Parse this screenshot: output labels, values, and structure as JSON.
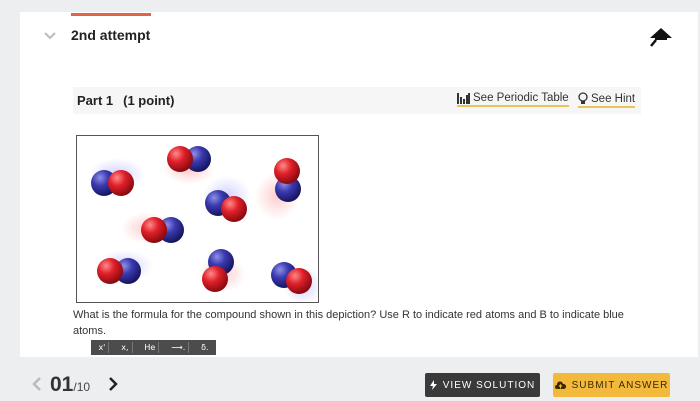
{
  "attempt": {
    "title": "2nd attempt"
  },
  "part": {
    "title": "Part 1",
    "points": "(1 point)",
    "periodic_table_link": "See Periodic Table",
    "hint_link": "See Hint"
  },
  "question": {
    "text": "What is the formula for the compound shown in this depiction? Use R to indicate red atoms and B to indicate blue atoms."
  },
  "toolbar": {
    "superscript": "x'",
    "subscript": "x,",
    "element": "He",
    "arrow": "⟶.",
    "delta": "δ."
  },
  "footer": {
    "page_current": "01",
    "page_total": "/10",
    "view_solution": "VIEW SOLUTION",
    "submit_answer": "SUBMIT ANSWER"
  },
  "colors": {
    "red_atom": "#e0202a",
    "blue_atom": "#3a3ab0",
    "accent_bar": "#e0644a",
    "submit": "#f2b93c",
    "view": "#3a3a3a"
  }
}
